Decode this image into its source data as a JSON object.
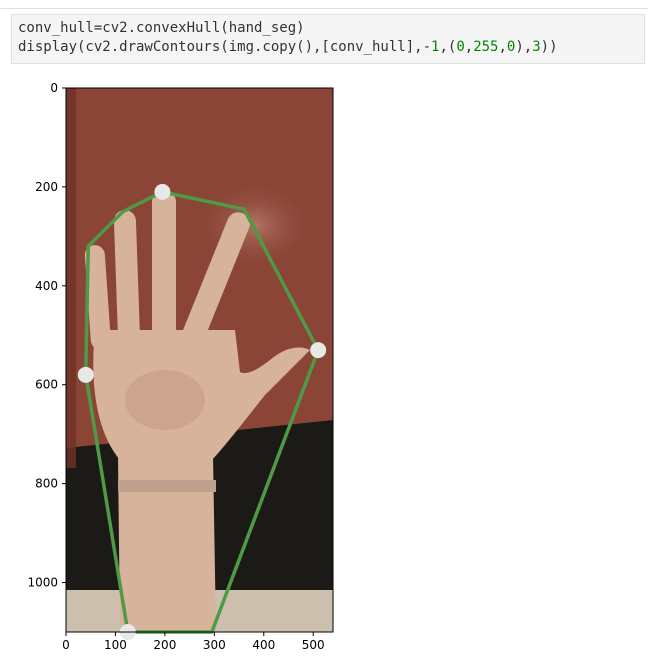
{
  "code": {
    "line1": "conv_hull=cv2.convexHull(hand_seg)",
    "line2_prefix": "display(cv2.drawContours(img.copy(),[conv_hull],-",
    "line2_n1": "1",
    "line2_sep1": ",(",
    "line2_n2": "0",
    "line2_sep2": ",",
    "line2_n3": "255",
    "line2_sep3": ",",
    "line2_n4": "0",
    "line2_sep4": "),",
    "line2_n5": "3",
    "line2_suffix": "))"
  },
  "figure": {
    "x_ticks": [
      "0",
      "100",
      "200",
      "300",
      "400",
      "500"
    ],
    "y_ticks": [
      "0",
      "200",
      "400",
      "600",
      "800",
      "1000"
    ],
    "hull_color": "#4e9a47",
    "point_color": "#e8e8e8",
    "image_aspect": {
      "width": 540,
      "height": 1100
    },
    "hull_points": [
      [
        195,
        210
      ],
      [
        360,
        245
      ],
      [
        510,
        530
      ],
      [
        295,
        1100
      ],
      [
        125,
        1100
      ],
      [
        40,
        580
      ],
      [
        45,
        320
      ],
      [
        115,
        250
      ]
    ],
    "marked_points": [
      [
        195,
        210
      ],
      [
        510,
        530
      ],
      [
        125,
        1100
      ],
      [
        40,
        580
      ]
    ]
  },
  "colors": {
    "wall": "#8a4536",
    "floor": "#1c1a17",
    "skin": "#d8b39b",
    "skin_shadow": "#b98d78",
    "cuff": "#c0a08f"
  }
}
